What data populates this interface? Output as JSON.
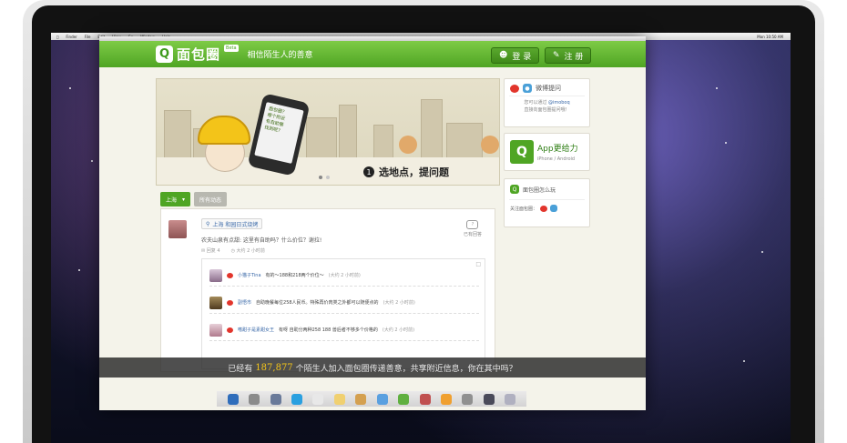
{
  "menubar": {
    "items": [
      "Finder",
      "File",
      "Edit",
      "View",
      "Go",
      "Window",
      "Help"
    ],
    "clock": "Mon 10:50 AM"
  },
  "site": {
    "logo_text": "面包圈",
    "beta": "Beta",
    "slogan": "相信陌生人的善意",
    "login": "登 录",
    "register": "注 册"
  },
  "banner": {
    "step_num": "1",
    "step_text": "选地点，提问题",
    "phone_lines": [
      "面包圈？",
      "哪个附近",
      "有自助餐",
      "找到呢？"
    ]
  },
  "sidebar": {
    "weibo_title": "微博提问",
    "weibo_desc1": "您可以通过",
    "weibo_handle": "@imoboq",
    "weibo_desc2": "直接向面包圈提问哦！",
    "app_title": "App更给力",
    "app_sub": "iPhone / Android",
    "how_title": "面包圈怎么玩",
    "follow_label": "关注面包圈："
  },
  "tabs": {
    "city": "上海",
    "all": "所有动态"
  },
  "post": {
    "location": "上海 和园日式烧烤",
    "question": "农夫山泉有点甜: 这里有自助吗？什么价位？谢拉!",
    "replies_count": "回复 4",
    "time": "大约 2 小时前",
    "answered_label": "已有回答",
    "answered_icon": "?"
  },
  "replies": [
    {
      "name": "小猫子Tina",
      "text": "有的～188和218两个价位～",
      "time": "(大约 2 小时前)"
    },
    {
      "name": "副悟市",
      "text": "自助晚餐每位258人民币。特殊再价肉类之外都可以随便点的",
      "time": "(大约 2 小时前)"
    },
    {
      "name": "嗜甜子是素甜女王",
      "text": "有呀 自助分两种258 188 兽后者不够多个价格的",
      "time": "(大约 2 小时前)"
    }
  ],
  "bottombar": {
    "prefix": "已经有",
    "count": "187,877",
    "suffix": "个陌生人加入面包圈传递善意，共享附近信息，你在其中吗？"
  },
  "colors": {
    "brand_green": "#4fa524",
    "accent_yellow": "#f3c419",
    "link_blue": "#3a69a8"
  }
}
